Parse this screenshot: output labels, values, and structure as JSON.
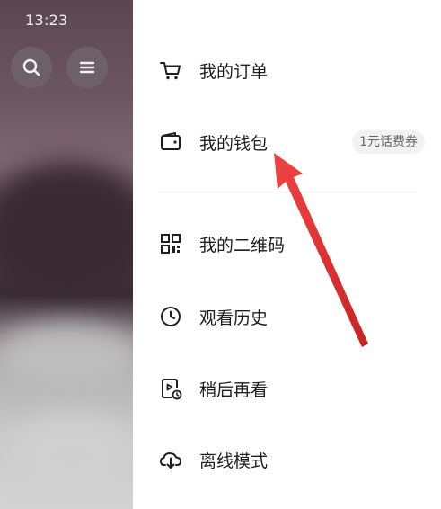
{
  "status_bar": {
    "time": "13:23"
  },
  "top_buttons": {
    "search_icon": "search-icon",
    "menu_icon": "menu-icon"
  },
  "drawer": {
    "items": [
      {
        "label": "我的订单",
        "icon": "cart-icon"
      },
      {
        "label": "我的钱包",
        "icon": "wallet-icon",
        "badge": "1元话费券"
      },
      {
        "label": "我的二维码",
        "icon": "qr-code-icon"
      },
      {
        "label": "观看历史",
        "icon": "clock-icon"
      },
      {
        "label": "稍后再看",
        "icon": "watch-later-icon"
      },
      {
        "label": "离线模式",
        "icon": "cloud-download-icon"
      }
    ]
  },
  "annotation": {
    "type": "red-arrow",
    "color": "#e52a2a",
    "points_to": "我的钱包"
  }
}
